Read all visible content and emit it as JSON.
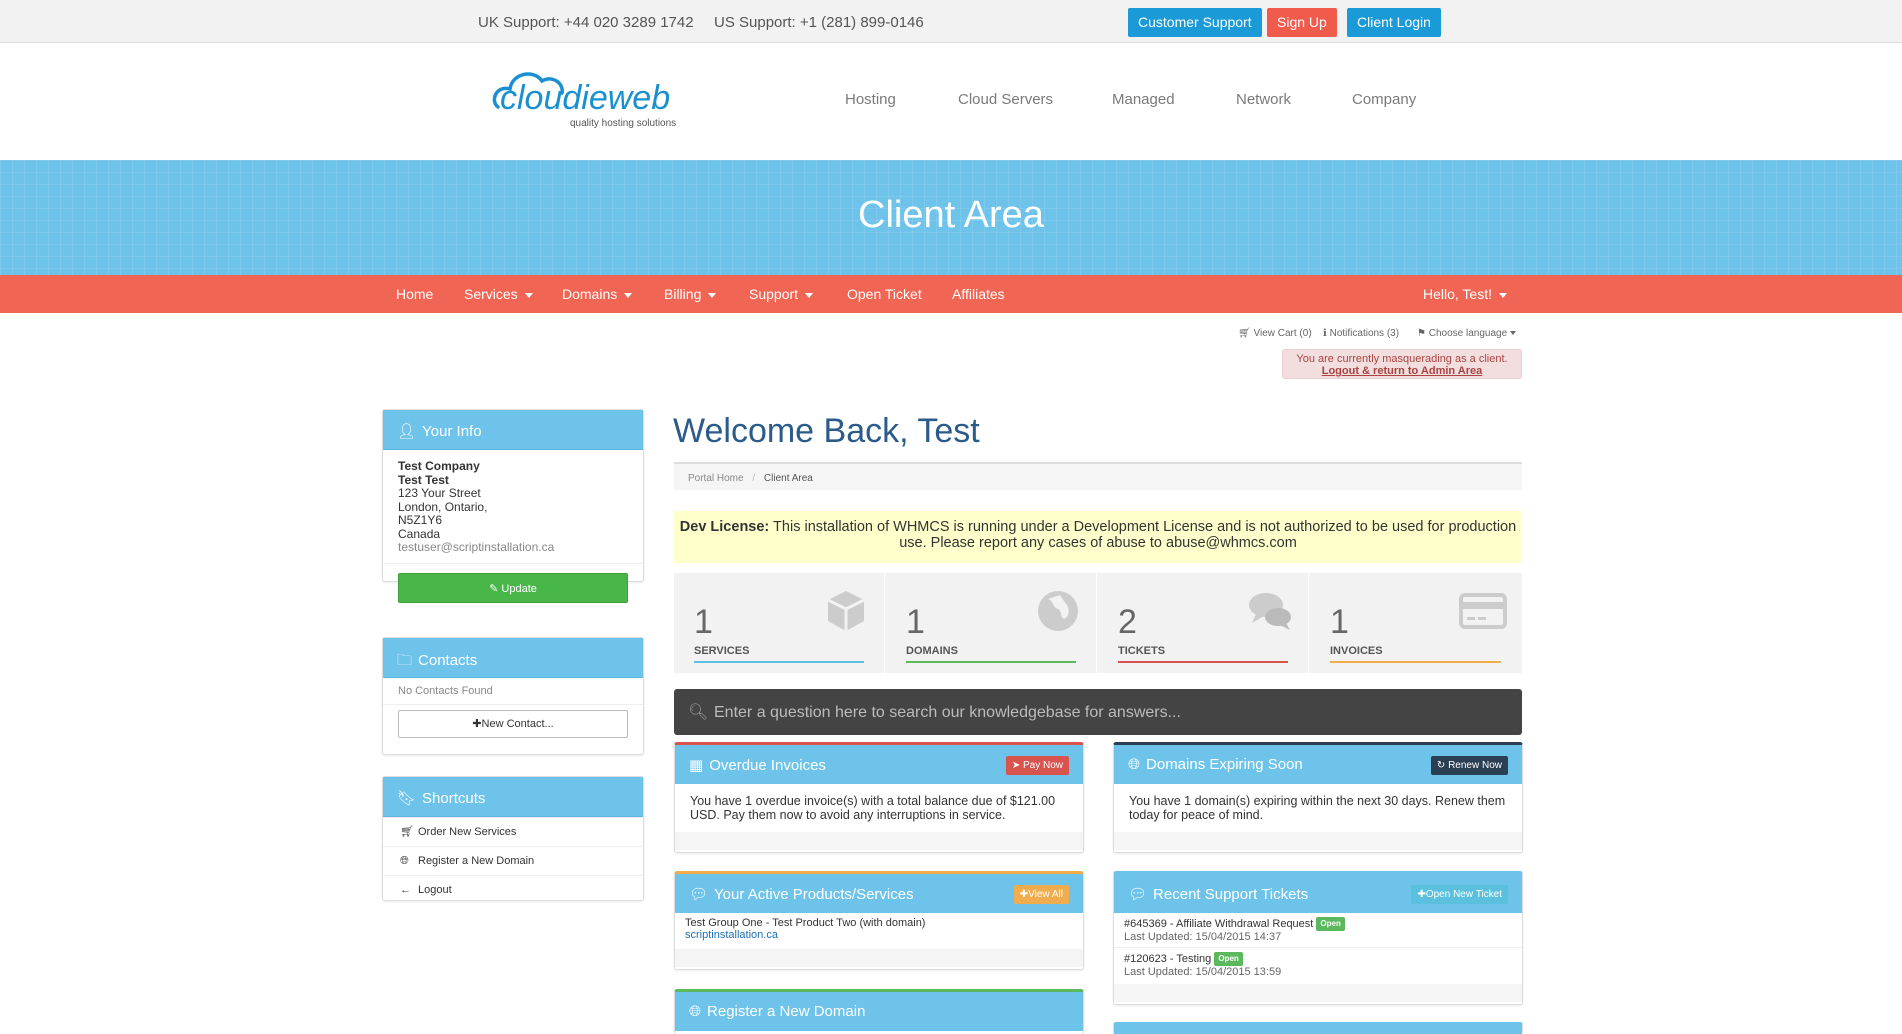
{
  "topbar": {
    "uk_support": "UK Support: +44 020 3289 1742",
    "us_support": "US Support: +1 (281) 899-0146",
    "customer_support": "Customer Support",
    "sign_up": "Sign Up",
    "client_login": "Client Login"
  },
  "logo": {
    "brand": "cloudieweb",
    "tagline": "quality hosting solutions"
  },
  "main_nav": [
    "Hosting",
    "Cloud Servers",
    "Managed",
    "Network",
    "Company"
  ],
  "banner": {
    "title": "Client Area"
  },
  "client_nav": {
    "items": [
      "Home",
      "Services",
      "Domains",
      "Billing",
      "Support",
      "Open Ticket",
      "Affiliates"
    ],
    "user": "Hello, Test!"
  },
  "utility": {
    "cart": "View Cart (0)",
    "notifications": "Notifications (3)",
    "language": "Choose language",
    "masquerade_text": "You are currently masquerading as a client.",
    "masquerade_link": "Logout & return to Admin Area"
  },
  "sidebar": {
    "your_info": {
      "title": "Your Info",
      "company": "Test Company",
      "name": "Test Test",
      "street": "123 Your Street",
      "city": "London, Ontario,",
      "postcode": "N5Z1Y6",
      "country": "Canada",
      "email": "testuser@scriptinstallation.ca",
      "update_button": "Update"
    },
    "contacts": {
      "title": "Contacts",
      "empty": "No Contacts Found",
      "new_button": "New Contact..."
    },
    "shortcuts": {
      "title": "Shortcuts",
      "items": [
        "Order New Services",
        "Register a New Domain",
        "Logout"
      ]
    }
  },
  "main": {
    "welcome": "Welcome Back, Test",
    "breadcrumb": {
      "home": "Portal Home",
      "separator": "/",
      "current": "Client Area"
    },
    "dev_license": {
      "label": "Dev License:",
      "text": "This installation of WHMCS is running under a Development License and is not authorized to be used for production use. Please report any cases of abuse to abuse@whmcs.com"
    },
    "stats": [
      {
        "value": "1",
        "label": "SERVICES",
        "color": "#5bc0de"
      },
      {
        "value": "1",
        "label": "DOMAINS",
        "color": "#5cb85c"
      },
      {
        "value": "2",
        "label": "TICKETS",
        "color": "#d9534f"
      },
      {
        "value": "1",
        "label": "INVOICES",
        "color": "#f0ad4e"
      }
    ],
    "kb_search": {
      "placeholder": "Enter a question here to search our knowledgebase for answers..."
    },
    "overdue": {
      "title": "Overdue Invoices",
      "button": "Pay Now",
      "text": "You have 1 overdue invoice(s) with a total balance due of $121.00 USD. Pay them now to avoid any interruptions in service."
    },
    "domains_expiring": {
      "title": "Domains Expiring Soon",
      "button": "Renew Now",
      "text": "You have 1 domain(s) expiring within the next 30 days. Renew them today for peace of mind."
    },
    "active_products": {
      "title": "Your Active Products/Services",
      "button": "View All",
      "product": "Test Group One - Test Product Two (with domain)",
      "domain": "scriptinstallation.ca"
    },
    "tickets": {
      "title": "Recent Support Tickets",
      "button": "Open New Ticket",
      "items": [
        {
          "subject": "#645369 - Affiliate Withdrawal Request",
          "status": "Open",
          "updated": "Last Updated: 15/04/2015 14:37"
        },
        {
          "subject": "#120623 - Testing",
          "status": "Open",
          "updated": "Last Updated: 15/04/2015 13:59"
        }
      ]
    },
    "register_domain": {
      "title": "Register a New Domain"
    }
  }
}
